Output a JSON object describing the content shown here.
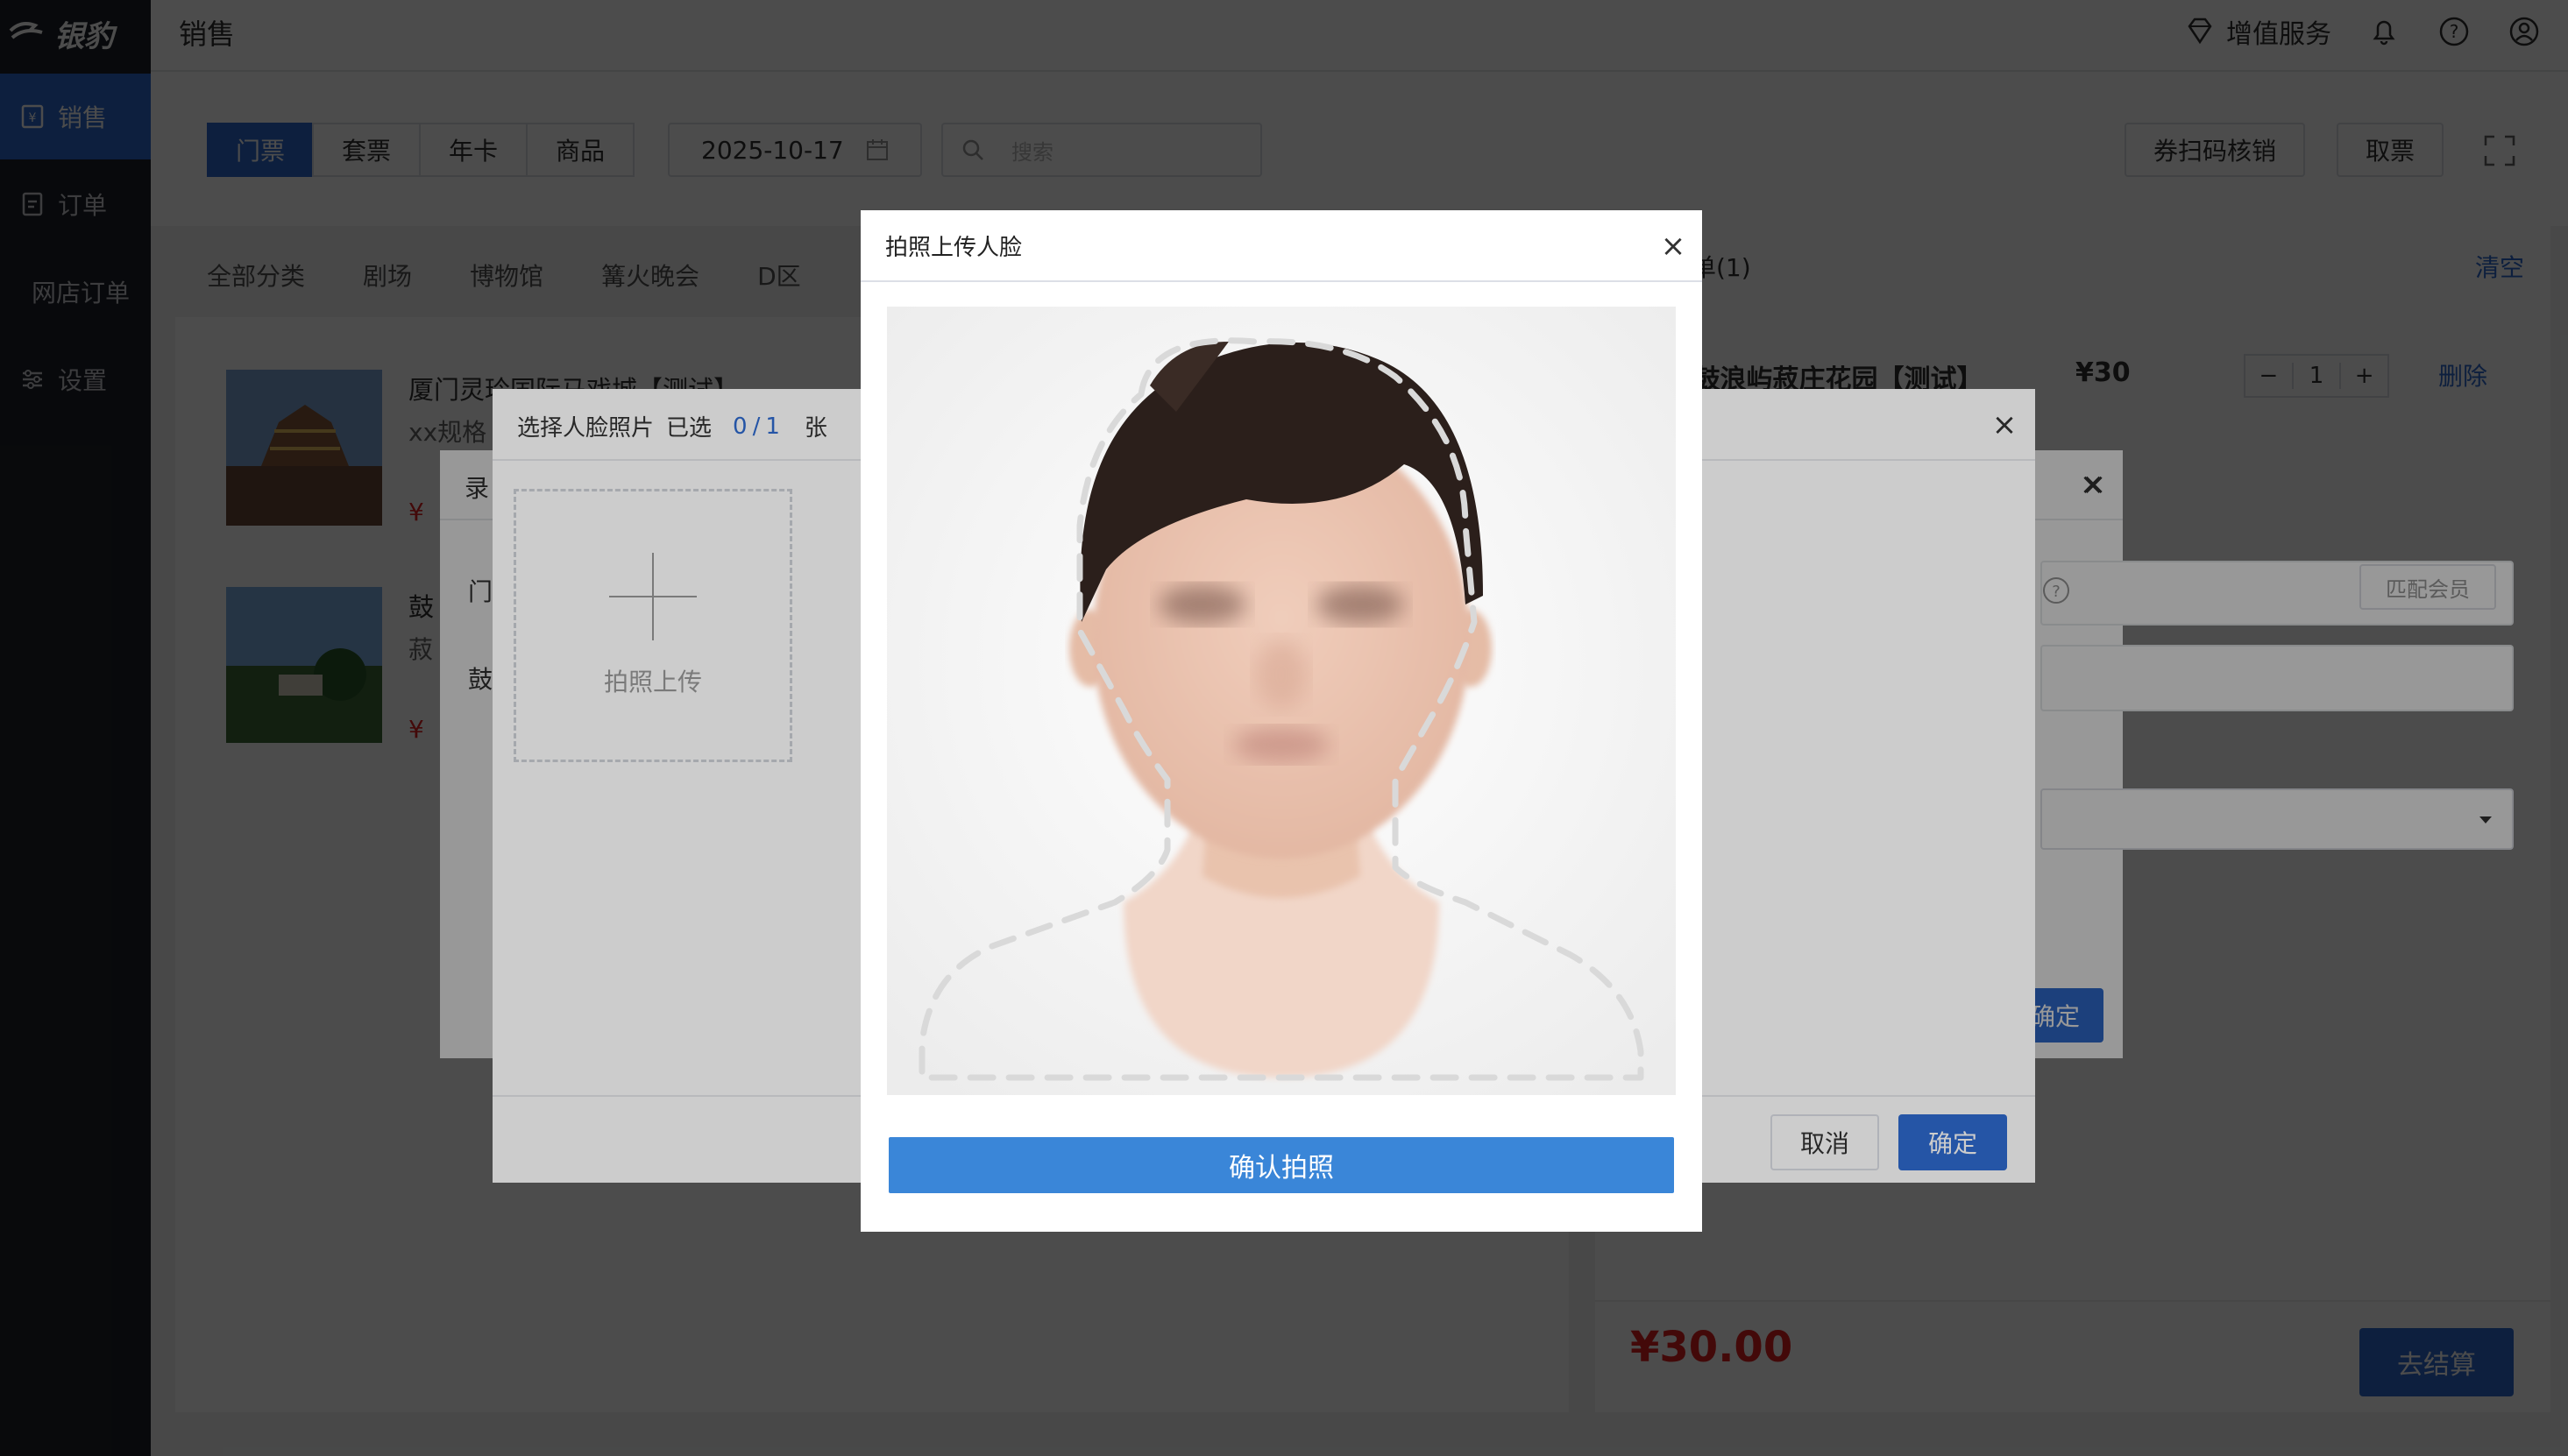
{
  "sidebar": {
    "logo_text": "银豹",
    "items": [
      {
        "label": "销售",
        "icon": "sales-icon",
        "active": true
      },
      {
        "label": "订单",
        "icon": "order-icon",
        "active": false
      },
      {
        "label": "网店订单",
        "icon": "",
        "active": false
      },
      {
        "label": "设置",
        "icon": "settings-icon",
        "active": false
      }
    ]
  },
  "header": {
    "title": "销售",
    "value_added_label": "增值服务"
  },
  "toolbar": {
    "tabs": [
      "门票",
      "套票",
      "年卡",
      "商品"
    ],
    "active_tab": 0,
    "date_value": "2025-10-17",
    "search_placeholder": "搜索",
    "scan_verify_label": "券扫码核销",
    "take_ticket_label": "取票"
  },
  "categories": [
    "全部分类",
    "剧场",
    "博物馆",
    "篝火晚会",
    "D区"
  ],
  "products": [
    {
      "name": "厦门灵玲国际马戏城【测试】",
      "spec": "xx规格",
      "price": "¥"
    },
    {
      "name": "鼓",
      "spec": "菽",
      "price": "¥"
    }
  ],
  "cart": {
    "title": "单(1)",
    "clear_label": "清空",
    "item_name": "-鼓浪屿菽庄花园【测试】",
    "item_price": "¥30",
    "qty": "1",
    "delete_label": "删除",
    "total": "¥30.00",
    "checkout_label": "去结算"
  },
  "record_dialog": {
    "title": "录",
    "field_label_1": "门",
    "field_label_2": "鼓",
    "match_member_label": "匹配会员",
    "confirm_label": "确定"
  },
  "select_dialog": {
    "title": "选择人脸照片",
    "selected_label": "已选",
    "selected_count": "0",
    "separator": "/",
    "max_count": "1",
    "unit": "张",
    "upload_label": "拍照上传",
    "cancel_label": "取消",
    "ok_label": "确定"
  },
  "photo_dialog": {
    "title": "拍照上传人脸",
    "confirm_label": "确认拍照"
  },
  "colors": {
    "primary": "#2f6bd0",
    "confirm_photo": "#3a86d8",
    "price_red": "#e02020",
    "sidebar_bg": "#1f2329"
  }
}
